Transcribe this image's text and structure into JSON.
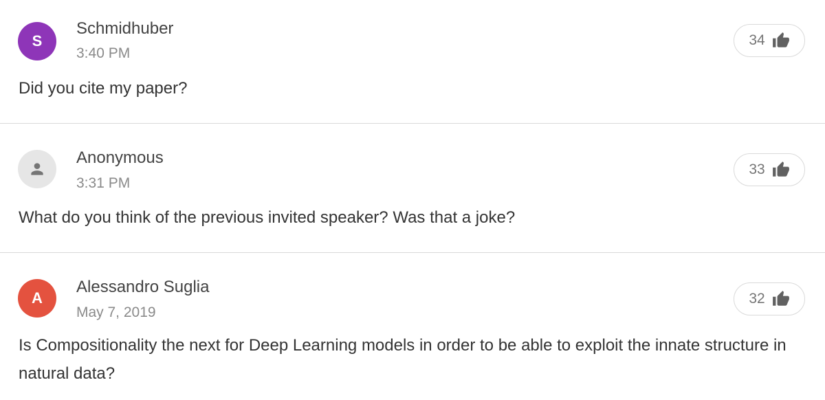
{
  "questions": [
    {
      "author": "Schmidhuber",
      "avatar_letter": "S",
      "avatar_color": "#8e35b8",
      "timestamp": "3:40 PM",
      "text": "Did you cite my paper?",
      "likes": "34",
      "like_icon": "thumbs-up-icon"
    },
    {
      "author": "Anonymous",
      "avatar_letter": "",
      "avatar_icon": "person-icon",
      "avatar_color": "#e6e6e6",
      "timestamp": "3:31 PM",
      "text": "What do you think of the previous invited speaker? Was that a joke?",
      "likes": "33",
      "like_icon": "thumbs-up-icon"
    },
    {
      "author": "Alessandro Suglia",
      "avatar_letter": "A",
      "avatar_color": "#e4523f",
      "timestamp": "May 7, 2019",
      "text": "Is Compositionality the next for Deep Learning models in order to be able to exploit the innate structure in natural data?",
      "likes": "32",
      "like_icon": "thumbs-up-icon"
    }
  ],
  "colors": {
    "divider": "#d9d9d9",
    "secondary_text": "#8a8a8a",
    "icon": "#616161"
  }
}
